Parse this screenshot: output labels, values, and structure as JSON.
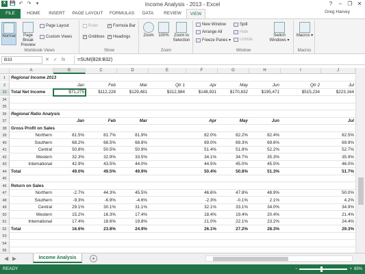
{
  "window": {
    "title": "Income Analysis - 2013 - Excel",
    "min": "–",
    "restore": "❐",
    "close": "✕",
    "help": "?"
  },
  "qat": [
    "X",
    "💾",
    "↶",
    "↷",
    "▾"
  ],
  "tabs": [
    "FILE",
    "HOME",
    "INSERT",
    "PAGE LAYOUT",
    "FORMULAS",
    "DATA",
    "REVIEW",
    "VIEW"
  ],
  "user": "Greg Harvey",
  "ribbon": {
    "workbook_views": {
      "label": "Workbook Views",
      "normal": "Normal",
      "page_break": "Page Break Preview",
      "page_layout": "Page Layout",
      "custom_views": "Custom Views"
    },
    "show": {
      "label": "Show",
      "ruler": "Ruler",
      "formula_bar": "Formula Bar",
      "gridlines": "Gridlines",
      "headings": "Headings"
    },
    "zoom": {
      "label": "Zoom",
      "zoom": "Zoom",
      "hundred": "100%",
      "to_selection": "Zoom to Selection"
    },
    "window": {
      "label": "Window",
      "new_window": "New Window",
      "arrange_all": "Arrange All",
      "freeze": "Freeze Panes ▾",
      "split": "Split",
      "hide": "Hide",
      "unhide": "Unhide",
      "switch": "Switch Windows ▾"
    },
    "macros": {
      "label": "Macros",
      "macros": "Macros ▾"
    }
  },
  "formula_bar": {
    "name_box": "B33",
    "cancel": "✕",
    "enter": "✓",
    "fx": "fx",
    "formula": "=SUM(B28:B32)"
  },
  "columns": [
    "A",
    "B",
    "C",
    "D",
    "E",
    "F",
    "G",
    "H",
    "I",
    "J"
  ],
  "active_column": "B",
  "rows": [
    {
      "n": "1",
      "cells": {
        "A": "Regional Income 2013"
      },
      "style": "bi"
    },
    {
      "n": "2",
      "cells": {
        "B": "Jan",
        "C": "Feb",
        "D": "Mar",
        "E": "Qtr 1",
        "F": "Apr",
        "G": "May",
        "H": "Jun",
        "I": "Qtr 2",
        "J": "Jul"
      },
      "style": "i"
    },
    {
      "n": "33",
      "cells": {
        "A": "Total Net Income",
        "B": "$71,275",
        "C": "$112,228",
        "D": "$129,481",
        "E": "$312,984",
        "F": "$148,931",
        "G": "$170,832",
        "H": "$195,471",
        "I": "$515,234",
        "J": "$223,164"
      },
      "style": "total"
    },
    {
      "n": "34",
      "cells": {}
    },
    {
      "n": "35",
      "cells": {}
    },
    {
      "n": "36",
      "cells": {
        "A": "Regional Ratio Analysis"
      },
      "style": "bi"
    },
    {
      "n": "37",
      "cells": {
        "B": "Jan",
        "C": "Feb",
        "D": "Mar",
        "F": "Apr",
        "G": "May",
        "H": "Jun",
        "J": "Jul"
      },
      "style": "bi"
    },
    {
      "n": "38",
      "cells": {
        "A": "Gross Profit on Sales"
      },
      "style": "b"
    },
    {
      "n": "39",
      "cells": {
        "A": "Northern",
        "B": "81.5%",
        "C": "81.7%",
        "D": "81.9%",
        "F": "82.0%",
        "G": "82.2%",
        "H": "82.4%",
        "J": "82.5%"
      }
    },
    {
      "n": "40",
      "cells": {
        "A": "Southern",
        "B": "68.2%",
        "C": "68.5%",
        "D": "68.8%",
        "F": "69.0%",
        "G": "69.3%",
        "H": "69.6%",
        "J": "69.9%"
      }
    },
    {
      "n": "41",
      "cells": {
        "A": "Central",
        "B": "50.8%",
        "C": "50.5%",
        "D": "50.9%",
        "F": "51.4%",
        "G": "51.8%",
        "H": "52.2%",
        "J": "52.7%"
      }
    },
    {
      "n": "42",
      "cells": {
        "A": "Western",
        "B": "32.3%",
        "C": "32.9%",
        "D": "33.5%",
        "F": "34.1%",
        "G": "34.7%",
        "H": "35.3%",
        "J": "35.9%"
      }
    },
    {
      "n": "43",
      "cells": {
        "A": "International",
        "B": "42.9%",
        "C": "43.5%",
        "D": "44.0%",
        "F": "44.5%",
        "G": "45.0%",
        "H": "45.5%",
        "J": "46.0%"
      }
    },
    {
      "n": "44",
      "cells": {
        "A": "Total",
        "B": "49.0%",
        "C": "49.5%",
        "D": "49.9%",
        "F": "50.4%",
        "G": "50.8%",
        "H": "51.3%",
        "J": "51.7%"
      },
      "style": "tot"
    },
    {
      "n": "45",
      "cells": {}
    },
    {
      "n": "46",
      "cells": {
        "A": "Return on Sales"
      },
      "style": "b"
    },
    {
      "n": "47",
      "cells": {
        "A": "Northern",
        "B": "-2.7%",
        "C": "44.3%",
        "D": "45.5%",
        "F": "46.6%",
        "G": "47.8%",
        "H": "48.9%",
        "J": "50.0%"
      }
    },
    {
      "n": "48",
      "cells": {
        "A": "Southern",
        "B": "-9.3%",
        "C": "-6.9%",
        "D": "-4.6%",
        "F": "-2.3%",
        "G": "-0.1%",
        "H": "2.1%",
        "J": "4.2%"
      }
    },
    {
      "n": "49",
      "cells": {
        "A": "Central",
        "B": "29.1%",
        "C": "30.1%",
        "D": "31.1%",
        "F": "32.1%",
        "G": "33.1%",
        "H": "34.0%",
        "J": "34.9%"
      }
    },
    {
      "n": "50",
      "cells": {
        "A": "Western",
        "B": "15.2%",
        "C": "16.3%",
        "D": "17.4%",
        "F": "18.4%",
        "G": "19.4%",
        "H": "20.4%",
        "J": "21.4%"
      }
    },
    {
      "n": "51",
      "cells": {
        "A": "International",
        "B": "17.4%",
        "C": "18.6%",
        "D": "19.8%",
        "F": "21.0%",
        "G": "22.1%",
        "H": "23.2%",
        "J": "24.4%"
      }
    },
    {
      "n": "52",
      "cells": {
        "A": "Total",
        "B": "16.6%",
        "C": "23.8%",
        "D": "24.9%",
        "F": "26.1%",
        "G": "27.2%",
        "H": "28.3%",
        "J": "29.3%"
      },
      "style": "tot"
    },
    {
      "n": "53",
      "cells": {}
    },
    {
      "n": "54",
      "cells": {}
    },
    {
      "n": "55",
      "cells": {}
    },
    {
      "n": "56",
      "cells": {}
    },
    {
      "n": "57",
      "cells": {}
    }
  ],
  "sheet_tab": "Income Analysis",
  "add_sheet": "+",
  "status": {
    "ready": "READY",
    "zoom": "85%",
    "minus": "−",
    "plus": "+"
  }
}
